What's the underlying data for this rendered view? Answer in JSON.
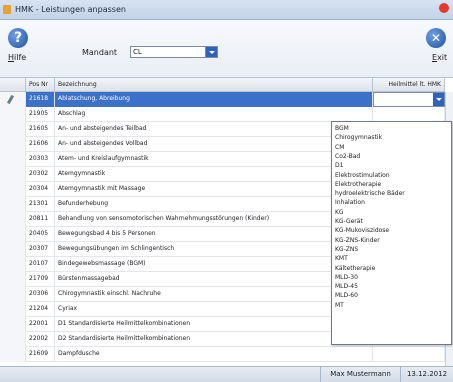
{
  "window": {
    "title": "HMK - Leistungen anpassen"
  },
  "toolbar": {
    "help_label_u": "H",
    "help_label_rest": "ilfe",
    "mandant_label": "Mandant",
    "mandant_value": "CL",
    "exit_label_u": "E",
    "exit_label_rest": "xit"
  },
  "grid": {
    "columns": [
      "Pos Nr",
      "Bezeichnung",
      "Heilmittel lt. HMK"
    ],
    "rows": [
      {
        "pos": "21618",
        "bez": "Ablatschung, Abreibung",
        "selected": true
      },
      {
        "pos": "21905",
        "bez": "Abschlag"
      },
      {
        "pos": "21605",
        "bez": "An- und absteigendes Teilbad"
      },
      {
        "pos": "21606",
        "bez": "An- und absteigendes Vollbad"
      },
      {
        "pos": "20303",
        "bez": "Atem- und Kreislaufgymnastik"
      },
      {
        "pos": "20302",
        "bez": "Atemgymnastik"
      },
      {
        "pos": "20304",
        "bez": "Atemgymnastik mit Massage"
      },
      {
        "pos": "21301",
        "bez": "Befunderhebung"
      },
      {
        "pos": "20811",
        "bez": "Behandlung von sensomotorischen Wahrnehmungsstörungen (Kinder)"
      },
      {
        "pos": "20405",
        "bez": "Bewegungsbad 4 bis 5 Personen"
      },
      {
        "pos": "20307",
        "bez": "Bewegungsübungen im Schlingentisch"
      },
      {
        "pos": "20107",
        "bez": "Bindegewebsmassage (BGM)"
      },
      {
        "pos": "21709",
        "bez": "Bürstenmassagebad"
      },
      {
        "pos": "20306",
        "bez": "Chirogymnastik einschl. Nachruhe"
      },
      {
        "pos": "21204",
        "bez": "Cyriax"
      },
      {
        "pos": "22001",
        "bez": "D1 Standardisierte Heilmittelkombinationen"
      },
      {
        "pos": "22002",
        "bez": "D2 Standardisierte Heilmittelkombinationen"
      },
      {
        "pos": "21609",
        "bez": "Dampfdusche"
      }
    ]
  },
  "dropdown": {
    "options": [
      "BGM",
      "Chirogymnastik",
      "CM",
      "Co2-Bad",
      "D1",
      "Elektrostimulation",
      "Elektrotherapie",
      "hydroelektrische Bäder",
      "Inhalation",
      "KG",
      "KG-Gerät",
      "KG-Mukoviszidose",
      "KG-ZNS-Kinder",
      "KG-ZNS",
      "KMT",
      "Kältetherapie",
      "MLD-30",
      "MLD-45",
      "MLD-60",
      "MT"
    ]
  },
  "status": {
    "user": "Max Mustermann",
    "date": "13.12.2012"
  }
}
